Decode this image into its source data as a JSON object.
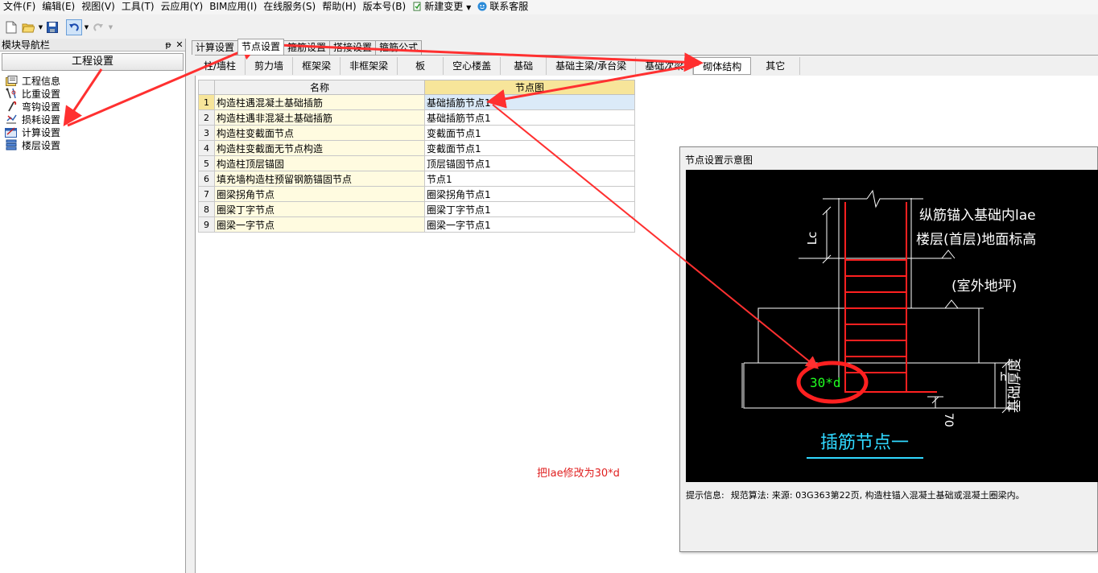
{
  "menu": [
    {
      "label": "文件(F)"
    },
    {
      "label": "编辑(E)"
    },
    {
      "label": "视图(V)"
    },
    {
      "label": "工具(T)"
    },
    {
      "label": "云应用(Y)"
    },
    {
      "label": "BIM应用(I)"
    },
    {
      "label": "在线服务(S)"
    },
    {
      "label": "帮助(H)"
    },
    {
      "label": "版本号(B)"
    },
    {
      "label": "新建变更"
    },
    {
      "label": "联系客服"
    }
  ],
  "nav": {
    "title": "模块导航栏",
    "header": "工程设置",
    "items": [
      {
        "label": "工程信息",
        "icon": "project-info-icon"
      },
      {
        "label": "比重设置",
        "icon": "weight-icon"
      },
      {
        "label": "弯钩设置",
        "icon": "hook-icon"
      },
      {
        "label": "损耗设置",
        "icon": "loss-icon"
      },
      {
        "label": "计算设置",
        "icon": "calc-icon"
      },
      {
        "label": "楼层设置",
        "icon": "floor-icon"
      }
    ]
  },
  "tabs": [
    {
      "label": "计算设置"
    },
    {
      "label": "节点设置",
      "active": true
    },
    {
      "label": "箍筋设置"
    },
    {
      "label": "搭接设置"
    },
    {
      "label": "箍筋公式"
    }
  ],
  "subtabs": [
    {
      "label": "柱/墙柱"
    },
    {
      "label": "剪力墙"
    },
    {
      "label": "框架梁"
    },
    {
      "label": "非框架梁"
    },
    {
      "label": "板"
    },
    {
      "label": "空心楼盖"
    },
    {
      "label": "基础"
    },
    {
      "label": "基础主梁/承台梁"
    },
    {
      "label": "基础次梁"
    },
    {
      "label": "砌体结构",
      "active": true
    },
    {
      "label": "其它"
    }
  ],
  "grid": {
    "headers": {
      "name": "名称",
      "node": "节点图"
    },
    "rows": [
      {
        "n": "1",
        "name": "构造柱遇混凝土基础插筋",
        "node": "基础插筋节点1"
      },
      {
        "n": "2",
        "name": "构造柱遇非混凝土基础插筋",
        "node": "基础插筋节点1"
      },
      {
        "n": "3",
        "name": "构造柱变截面节点",
        "node": "变截面节点1"
      },
      {
        "n": "4",
        "name": "构造柱变截面无节点构造",
        "node": "变截面节点1"
      },
      {
        "n": "5",
        "name": "构造柱顶层锚固",
        "node": "顶层锚固节点1"
      },
      {
        "n": "6",
        "name": "填充墙构造柱预留钢筋锚固节点",
        "node": "节点1"
      },
      {
        "n": "7",
        "name": "圈梁拐角节点",
        "node": "圈梁拐角节点1"
      },
      {
        "n": "8",
        "name": "圈梁丁字节点",
        "node": "圈梁丁字节点1"
      },
      {
        "n": "9",
        "name": "圈梁一字节点",
        "node": "圈梁一字节点1"
      }
    ]
  },
  "annotation": "把lae修改为30*d",
  "dialog": {
    "title": "节点设置示意图",
    "diagram": {
      "label_anchor": "纵筋锚入基础内lae",
      "label_floor": "楼层(首层)地面标高",
      "label_outdoor": "(室外地坪)",
      "label_lc": "Lc",
      "label_value": "30*d",
      "label_70": "70",
      "label_h": "h",
      "label_thickness": "基础厚度",
      "caption": "插筋节点一"
    },
    "hint_label": "提示信息:",
    "hint_text": "规范算法: 来源: 03G363第22页, 构造柱锚入混凝土基础或混凝土圈梁内。"
  },
  "colors": {
    "rebar": "#ff2020",
    "dim_line": "#ffffff",
    "value_text": "#20ff20",
    "caption": "#30d8ff",
    "annotation": "#e02020"
  }
}
